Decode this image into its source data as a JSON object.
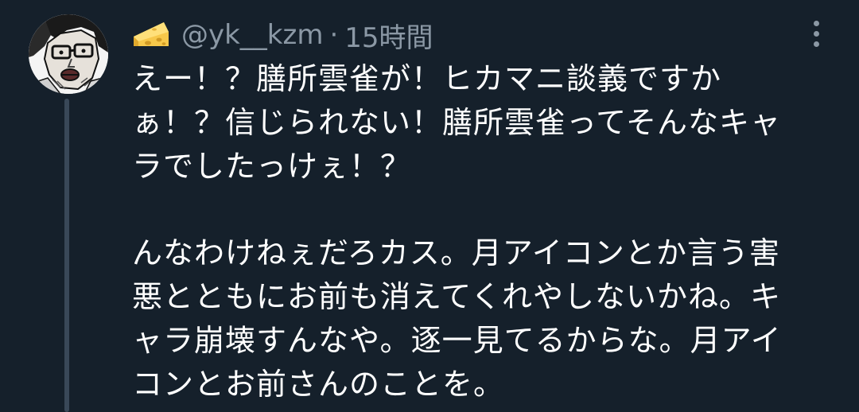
{
  "tweet": {
    "handle": "@yk__kzm",
    "separator": "·",
    "timestamp": "15時間",
    "name_emoji_icon": "cheese-icon",
    "more_icon": "more-vertical-icon",
    "avatar_icon": "manga-face-avatar",
    "body": {
      "paragraph1": [
        "えー！？膳所雲雀が！ヒカマニ談義ですか",
        "ぁ！？信じられない！膳所雲雀ってそんなキャ",
        "ラでしたっけぇ！？"
      ],
      "paragraph2": [
        "んなわけねぇだろカス。月アイコンとか言う害",
        "悪とともにお前も消えてくれやしないかね。キ",
        "ャラ崩壊すんなや。逐一見てるからな。月アイ",
        "コンとお前さんのことを。"
      ]
    }
  },
  "colors": {
    "background": "#15202b",
    "text": "#ffffff",
    "secondary_text": "#8b98a5",
    "thread_line": "#394858"
  }
}
